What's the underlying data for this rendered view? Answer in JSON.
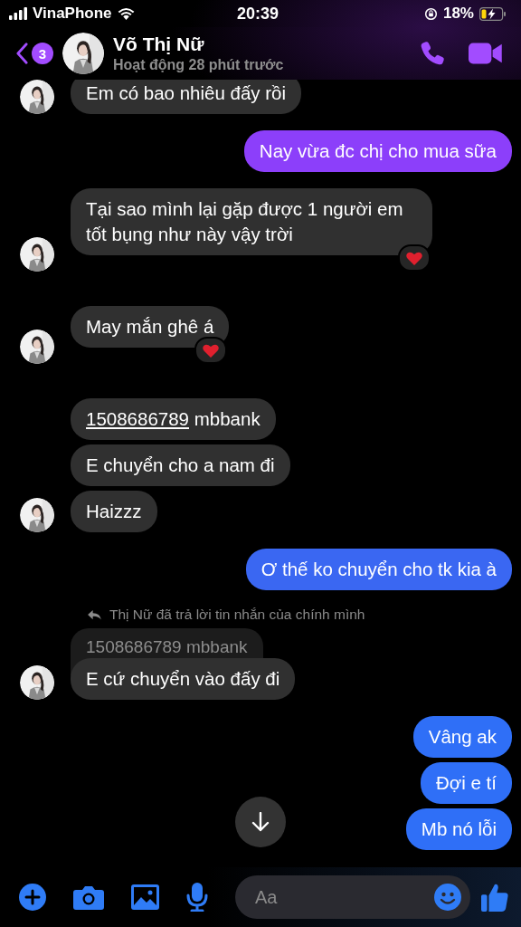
{
  "status_bar": {
    "carrier": "VinaPhone",
    "time": "20:39",
    "battery": "18%"
  },
  "header": {
    "back_badge": "3",
    "name": "Võ Thị Nữ",
    "status": "Hoạt động 28 phút trước"
  },
  "messages": [
    {
      "kind": "incoming",
      "text": "Em có bao nhiêu đấy rồi",
      "avatar": true,
      "reacted": false
    },
    {
      "kind": "outgoing",
      "text": "Nay vừa đc chị cho mua sữa",
      "color": "#8c3ffa"
    },
    {
      "kind": "incoming",
      "text": "Tại sao mình lại gặp được 1 người em tốt bụng như này vậy trời",
      "avatar": true,
      "reacted": true
    },
    {
      "kind": "incoming",
      "text": "May mắn ghê á",
      "avatar": true,
      "reacted": true
    },
    {
      "kind": "incoming",
      "link": "1508686789",
      "text": "mbbank",
      "avatar": false,
      "reacted": false
    },
    {
      "kind": "incoming",
      "text": "E chuyển cho a nam đi",
      "avatar": false,
      "reacted": false
    },
    {
      "kind": "incoming",
      "text": "Haizzz",
      "avatar": true,
      "reacted": false
    },
    {
      "kind": "outgoing",
      "text": "Ơ thế ko chuyển cho tk kia à",
      "color": "#3a67f2"
    },
    {
      "kind": "reply_note",
      "text": "Thị Nữ đã trả lời tin nhắn của chính mình"
    },
    {
      "kind": "quoted",
      "text": "1508686789 mbbank"
    },
    {
      "kind": "incoming",
      "text": "E cứ chuyển vào đấy đi",
      "avatar": true,
      "reacted": false
    },
    {
      "kind": "outgoing",
      "text": "Vâng ak",
      "color": "#2f6ff7"
    },
    {
      "kind": "outgoing",
      "text": "Đợi e tí",
      "color": "#2f6ff7"
    },
    {
      "kind": "outgoing",
      "text": "Mb nó lỗi",
      "color": "#2f6ff7"
    }
  ],
  "composer": {
    "placeholder": "Aa"
  }
}
